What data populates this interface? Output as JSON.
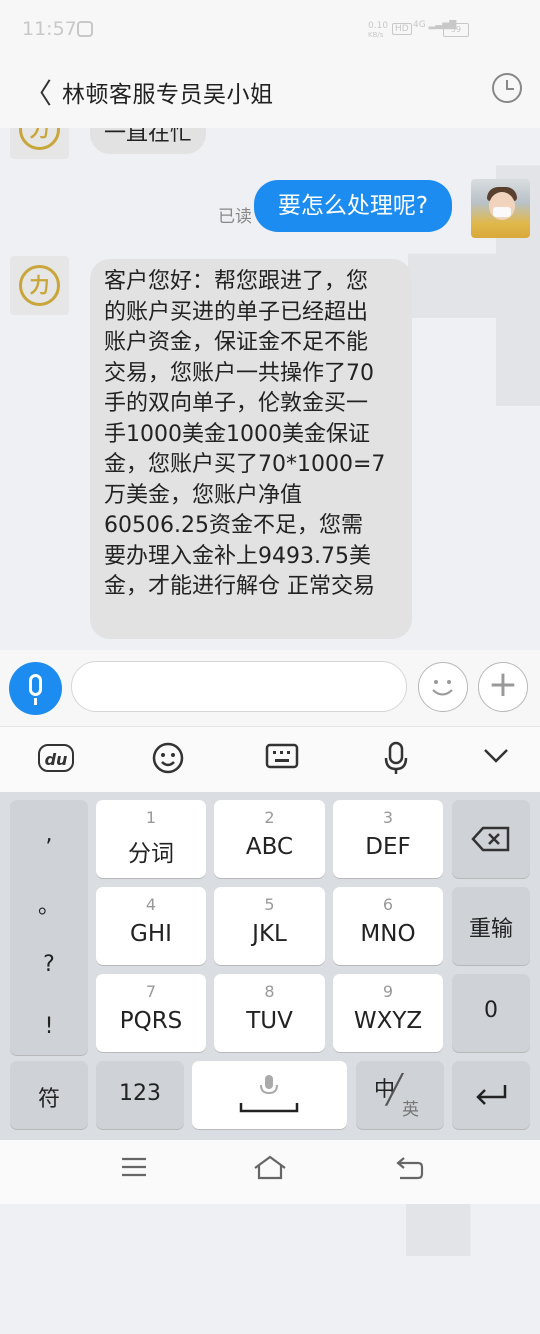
{
  "status_bar": {
    "time": "11:57",
    "net_speed": "0.10",
    "net_unit": "KB/s",
    "hd": "HD",
    "network": "4G",
    "battery": "59"
  },
  "header": {
    "back_icon": "chevron-left-icon",
    "title": "林顿客服专员吴小姐",
    "history_icon": "clock-icon"
  },
  "chat": {
    "partial_message": "一直在忙",
    "outgoing": {
      "text": "要怎么处理呢?",
      "status": "已读"
    },
    "incoming_lines": [
      "客户您好：帮您跟进了，您",
      "的账户买进的单子已经超出",
      "账户资金，保证金不足不能",
      "交易，您账户一共操作了70",
      "手的双向单子，伦敦金买一",
      "手1000美金1000美金保证",
      "金，您账户买了70*1000=7",
      "万美金，您账户净值",
      "60506.25资金不足，您需",
      "要办理入金补上9493.75美",
      "金，才能进行解仓 正常交易"
    ],
    "agent_logo": "力"
  },
  "input_bar": {
    "placeholder": "",
    "voice_icon": "microphone-icon",
    "emoji_icon": "smiley-icon",
    "plus_icon": "plus-icon"
  },
  "keyboard_toolbar": {
    "du_logo": "du",
    "emoji_icon": "smiley-icon",
    "keyboard_icon": "keyboard-icon",
    "voice_icon": "microphone-icon",
    "collapse_icon": "chevron-down-icon"
  },
  "keyboard": {
    "punct": [
      ",",
      "。",
      "?",
      "!"
    ],
    "keys": [
      {
        "num": "1",
        "label": "分词"
      },
      {
        "num": "2",
        "label": "ABC"
      },
      {
        "num": "3",
        "label": "DEF"
      },
      {
        "num": "4",
        "label": "GHI"
      },
      {
        "num": "5",
        "label": "JKL"
      },
      {
        "num": "6",
        "label": "MNO"
      },
      {
        "num": "7",
        "label": "PQRS"
      },
      {
        "num": "8",
        "label": "TUV"
      },
      {
        "num": "9",
        "label": "WXYZ"
      }
    ],
    "backspace_icon": "backspace-icon",
    "reinput": "重输",
    "zero": "0",
    "symbols": "符",
    "numbers": "123",
    "space_icon": "space-mic-icon",
    "lang_cn": "中",
    "lang_en": "英",
    "enter_icon": "enter-icon"
  },
  "nav_bar": {
    "menu_icon": "menu-icon",
    "home_icon": "home-icon",
    "back_icon": "back-icon"
  }
}
